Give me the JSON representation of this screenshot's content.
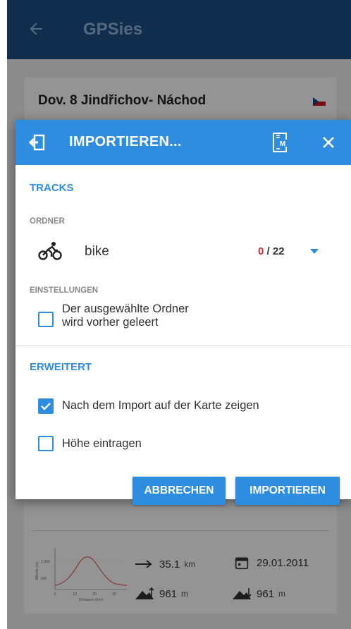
{
  "app": {
    "title": "GPSies"
  },
  "track_card": {
    "name": "Dov. 8 Jindřichov- Náchod"
  },
  "stats": {
    "distance_value": "35.1",
    "distance_unit": "km",
    "date": "29.01.2011",
    "ascent_value": "961",
    "ascent_unit": "m",
    "descent_value": "961",
    "descent_unit": "m",
    "chart_y_label": "Altitude (m)",
    "chart_x_label": "Distance (km)",
    "chart_y_ticks": [
      "1,000",
      "500"
    ],
    "chart_x_ticks": [
      "0",
      "10",
      "20",
      "30"
    ]
  },
  "dialog": {
    "title": "IMPORTIEREN...",
    "tracks_section": "TRACKS",
    "folder_label": "ORDNER",
    "folder_name": "bike",
    "count_selected": "0",
    "count_total": " / 22",
    "settings_label": "EINSTELLUNGEN",
    "clear_folder_line1": "Der ausgewählte Ordner",
    "clear_folder_line2": "wird vorher geleert",
    "clear_folder_checked": false,
    "advanced_section": "ERWEITERT",
    "show_on_map": "Nach dem Import auf der Karte zeigen",
    "show_on_map_checked": true,
    "add_elevation": "Höhe eintragen",
    "add_elevation_checked": false,
    "cancel_label": "ABBRECHEN",
    "import_label": "IMPORTIEREN"
  },
  "colors": {
    "accent": "#2f8ddf",
    "appbar": "#1e4f86",
    "count_selected": "#d32f2f"
  },
  "icons": [
    "back-arrow-icon",
    "import-icon",
    "m-file-icon",
    "close-icon",
    "bike-icon",
    "dropdown-icon",
    "check-icon",
    "distance-arrow-icon",
    "calendar-icon",
    "ascent-icon",
    "descent-icon",
    "czech-flag-icon"
  ]
}
